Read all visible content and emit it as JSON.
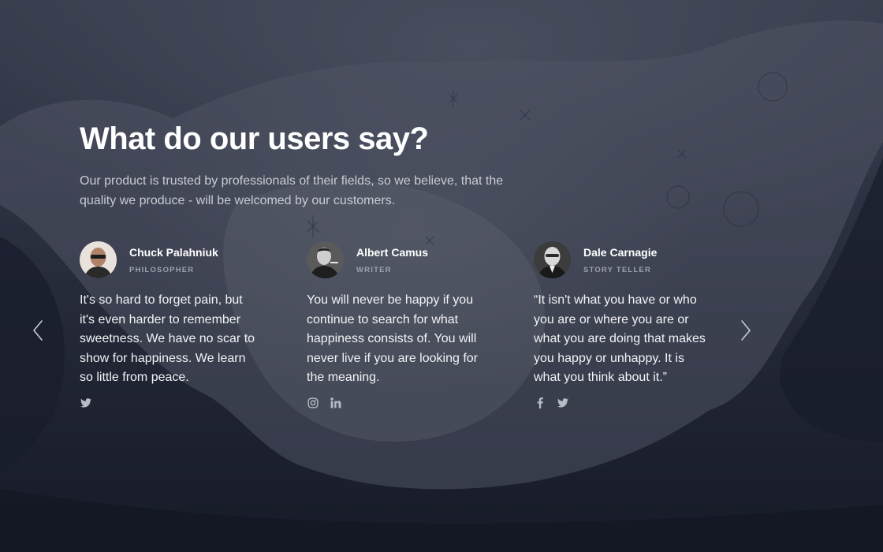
{
  "section": {
    "title": "What do our users say?",
    "subtitle": "Our product is trusted by professionals of their fields, so we believe, that the quality we produce - will be welcomed by our customers."
  },
  "testimonials": [
    {
      "name": "Chuck Palahniuk",
      "role": "PHILOSOPHER",
      "quote": "It's so hard to forget pain, but it's even harder to remember sweetness. We have no scar to show for happiness. We learn so little from peace.",
      "socials": [
        "twitter-icon"
      ]
    },
    {
      "name": "Albert Camus",
      "role": "WRITER",
      "quote": "You will never be happy if you continue to search for what happiness consists of. You will never live if you are looking for the meaning.",
      "socials": [
        "instagram-icon",
        "linkedin-icon"
      ]
    },
    {
      "name": "Dale Carnagie",
      "role": "STORY TELLER",
      "quote": "“It isn't what you have or who you are or where you are or what you are doing that makes you happy or unhappy. It is what you think about it.”",
      "socials": [
        "facebook-icon",
        "twitter-icon"
      ]
    }
  ],
  "navigation": {
    "prev_icon": "chevron-left-icon",
    "next_icon": "chevron-right-icon"
  },
  "colors": {
    "text": "#ffffff",
    "muted": "#c9ccd4",
    "role": "#9ea3b0",
    "icon": "#b7bbc6"
  }
}
